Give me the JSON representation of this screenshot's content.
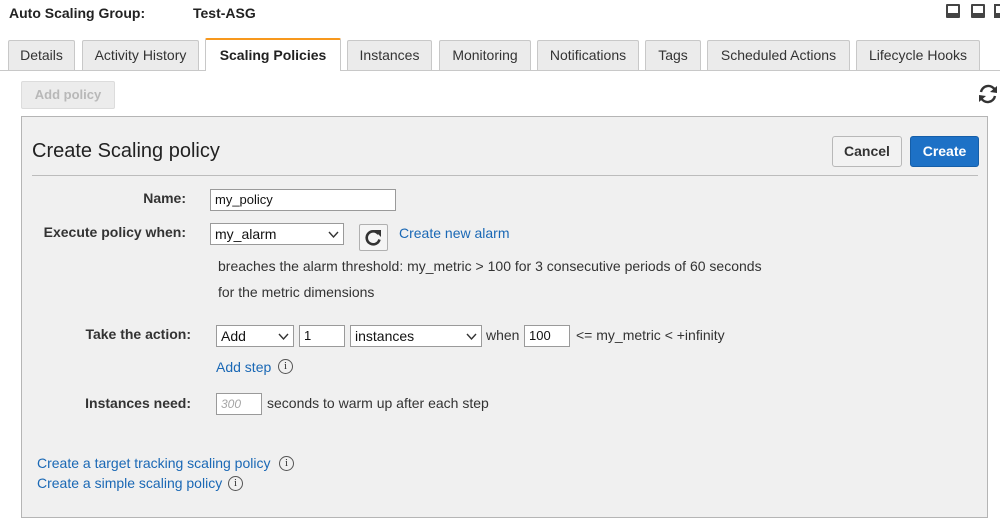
{
  "header": {
    "label": "Auto Scaling Group:",
    "value": "Test-ASG"
  },
  "tabs": [
    {
      "label": "Details"
    },
    {
      "label": "Activity History"
    },
    {
      "label": "Scaling Policies"
    },
    {
      "label": "Instances"
    },
    {
      "label": "Monitoring"
    },
    {
      "label": "Notifications"
    },
    {
      "label": "Tags"
    },
    {
      "label": "Scheduled Actions"
    },
    {
      "label": "Lifecycle Hooks"
    }
  ],
  "active_tab": "Scaling Policies",
  "toolbar": {
    "add_policy_label": "Add policy",
    "refresh_icon": "refresh-icon"
  },
  "panel": {
    "title": "Create Scaling policy",
    "cancel_label": "Cancel",
    "create_label": "Create",
    "name": {
      "label": "Name:",
      "value": "my_policy"
    },
    "execute": {
      "label": "Execute policy when:",
      "alarm_value": "my_alarm",
      "create_alarm_link": "Create new alarm",
      "desc_line1": "breaches the alarm threshold: my_metric > 100 for 3 consecutive periods of 60 seconds",
      "desc_line2": "for the metric dimensions"
    },
    "action": {
      "label": "Take the action:",
      "operation": "Add",
      "amount": "1",
      "unit": "instances",
      "when_label": "when",
      "lower_bound": "100",
      "bound_text": "<= my_metric < +infinity",
      "add_step_link": "Add step"
    },
    "warmup": {
      "label": "Instances need:",
      "placeholder": "300",
      "suffix": "seconds to warm up after each step"
    },
    "links": {
      "target_tracking": "Create a target tracking scaling policy",
      "simple": "Create a simple scaling policy"
    },
    "info_glyph": "i"
  },
  "colors": {
    "accent_tab": "#f7981d",
    "primary_button": "#1d71c6",
    "link": "#1a68b5"
  }
}
